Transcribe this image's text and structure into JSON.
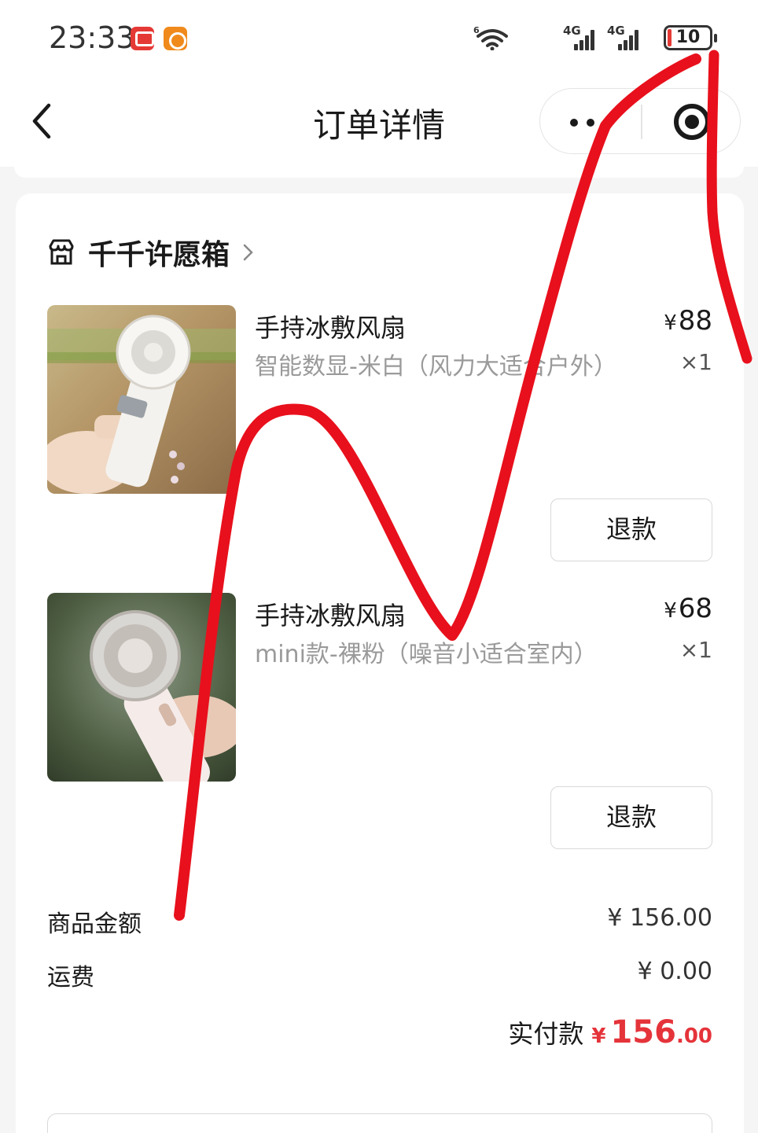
{
  "status_bar": {
    "time": "23:33",
    "battery_level": "10",
    "network_1": "4G",
    "network_2": "4G",
    "wifi_badge": "6"
  },
  "nav": {
    "title": "订单详情"
  },
  "shop": {
    "name": "千千许愿箱"
  },
  "products": [
    {
      "title": "手持冰敷风扇",
      "spec": "智能数显-米白（风力大适合户外）",
      "price_symbol": "¥",
      "price": "88",
      "quantity": "×1",
      "refund_label": "退款"
    },
    {
      "title": "手持冰敷风扇",
      "spec": "mini款-裸粉（噪音小适合室内）",
      "price_symbol": "¥",
      "price": "68",
      "quantity": "×1",
      "refund_label": "退款"
    }
  ],
  "summary": {
    "goods_amount_label": "商品金额",
    "goods_amount_value": "¥ 156.00",
    "shipping_label": "运费",
    "shipping_value": "¥ 0.00",
    "paid_label": "实付款",
    "paid_symbol": "¥",
    "paid_integer": "156",
    "paid_decimal": ".00"
  },
  "colors": {
    "accent_red": "#e5333a",
    "scribble_red": "#e8101c"
  }
}
